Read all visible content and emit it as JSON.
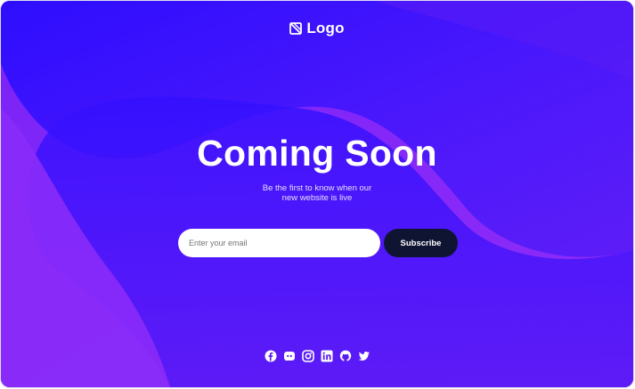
{
  "brand": {
    "logo_text": "Logo"
  },
  "hero": {
    "title": "Coming Soon",
    "subtitle_line1": "Be the first to know when our",
    "subtitle_line2": "new website is live"
  },
  "form": {
    "email_placeholder": "Enter your email",
    "subscribe_label": "Subscribe"
  },
  "social_icons": [
    "facebook-icon",
    "discord-icon",
    "instagram-icon",
    "linkedin-icon",
    "github-icon",
    "twitter-icon"
  ],
  "colors": {
    "background_primary": "#6a1ff2",
    "background_blob": "#3b10ff",
    "button": "#0f1433",
    "text": "#ffffff"
  }
}
